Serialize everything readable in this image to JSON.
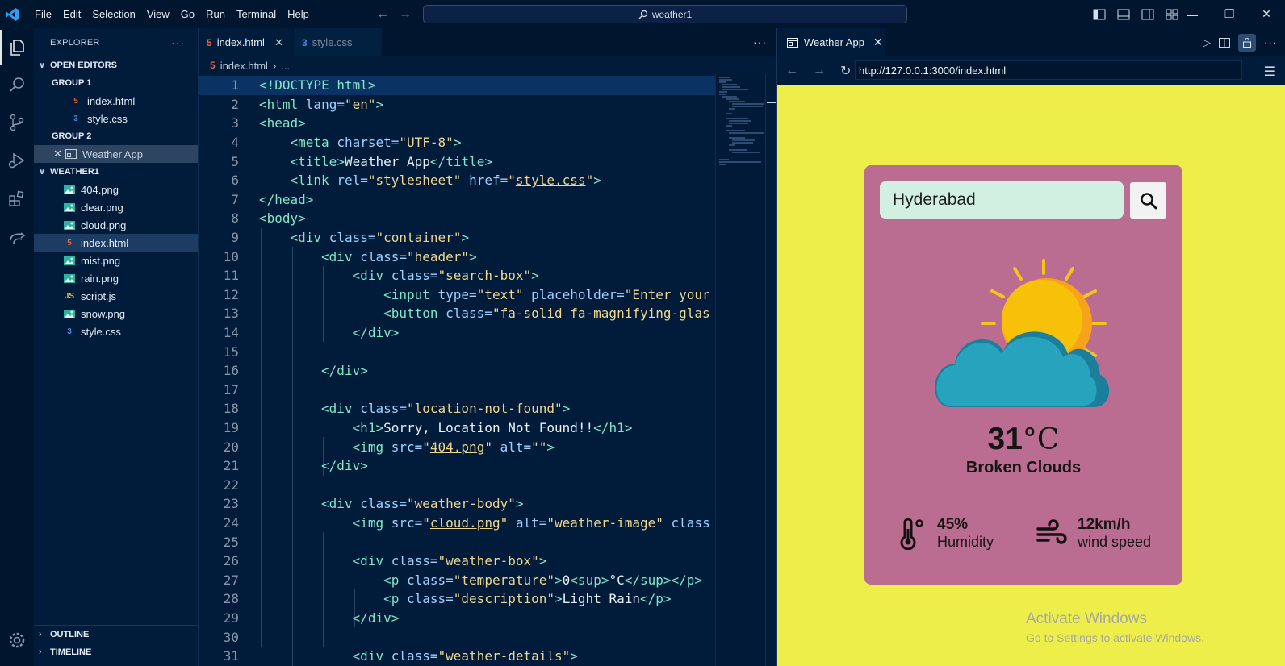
{
  "menubar": [
    "File",
    "Edit",
    "Selection",
    "View",
    "Go",
    "Run",
    "Terminal",
    "Help"
  ],
  "command_center": {
    "label": "weather1"
  },
  "explorer": {
    "title": "EXPLORER",
    "open_editors": {
      "label": "OPEN EDITORS",
      "group1": {
        "label": "GROUP 1",
        "files": [
          {
            "name": "index.html",
            "type": "html"
          },
          {
            "name": "style.css",
            "type": "css"
          }
        ]
      },
      "group2": {
        "label": "GROUP 2",
        "files": [
          {
            "name": "Weather App",
            "type": "preview"
          }
        ]
      }
    },
    "folder": {
      "label": "WEATHER1",
      "files": [
        {
          "name": "404.png",
          "type": "png"
        },
        {
          "name": "clear.png",
          "type": "png"
        },
        {
          "name": "cloud.png",
          "type": "png"
        },
        {
          "name": "index.html",
          "type": "html",
          "selected": true
        },
        {
          "name": "mist.png",
          "type": "png"
        },
        {
          "name": "rain.png",
          "type": "png"
        },
        {
          "name": "script.js",
          "type": "js"
        },
        {
          "name": "snow.png",
          "type": "png"
        },
        {
          "name": "style.css",
          "type": "css"
        }
      ]
    },
    "outline": "OUTLINE",
    "timeline": "TIMELINE"
  },
  "editor": {
    "tabs": [
      {
        "label": "index.html",
        "active": true
      },
      {
        "label": "style.css",
        "active": false
      }
    ],
    "breadcrumb": {
      "file": "index.html",
      "rest": "..."
    },
    "lines": [
      {
        "n": "1",
        "i": 0,
        "s": [
          [
            "tg",
            "<!DOCTYPE html>"
          ]
        ]
      },
      {
        "n": "2",
        "i": 0,
        "s": [
          [
            "tg",
            "<html "
          ],
          [
            "at",
            "lang="
          ],
          [
            "st",
            "\"en\""
          ],
          [
            "tg",
            ">"
          ]
        ]
      },
      {
        "n": "3",
        "i": 0,
        "s": [
          [
            "tg",
            "<head>"
          ]
        ]
      },
      {
        "n": "4",
        "i": 1,
        "s": [
          [
            "tg",
            "<meta "
          ],
          [
            "at",
            "charset="
          ],
          [
            "st",
            "\"UTF-8\""
          ],
          [
            "tg",
            ">"
          ]
        ]
      },
      {
        "n": "5",
        "i": 1,
        "s": [
          [
            "tg",
            "<title>"
          ],
          [
            "tx",
            "Weather App"
          ],
          [
            "tg",
            "</title>"
          ]
        ]
      },
      {
        "n": "6",
        "i": 1,
        "s": [
          [
            "tg",
            "<link "
          ],
          [
            "at",
            "rel="
          ],
          [
            "st",
            "\"stylesheet\""
          ],
          [
            "at",
            " href="
          ],
          [
            "st",
            "\""
          ],
          [
            "stu",
            "style.css"
          ],
          [
            "st",
            "\""
          ],
          [
            "tg",
            ">"
          ]
        ]
      },
      {
        "n": "7",
        "i": 0,
        "s": [
          [
            "tg",
            "</head>"
          ]
        ]
      },
      {
        "n": "8",
        "i": 0,
        "s": [
          [
            "tg",
            "<body>"
          ]
        ]
      },
      {
        "n": "9",
        "i": 1,
        "s": [
          [
            "tg",
            "<div "
          ],
          [
            "at",
            "class="
          ],
          [
            "st",
            "\"container\""
          ],
          [
            "tg",
            ">"
          ]
        ]
      },
      {
        "n": "10",
        "i": 2,
        "s": [
          [
            "tg",
            "<div "
          ],
          [
            "at",
            "class="
          ],
          [
            "st",
            "\"header\""
          ],
          [
            "tg",
            ">"
          ]
        ]
      },
      {
        "n": "11",
        "i": 3,
        "s": [
          [
            "tg",
            "<div "
          ],
          [
            "at",
            "class="
          ],
          [
            "st",
            "\"search-box\""
          ],
          [
            "tg",
            ">"
          ]
        ]
      },
      {
        "n": "12",
        "i": 4,
        "s": [
          [
            "tg",
            "<input "
          ],
          [
            "at",
            "type="
          ],
          [
            "st",
            "\"text\""
          ],
          [
            "at",
            " placeholder="
          ],
          [
            "st",
            "\"Enter your"
          ]
        ]
      },
      {
        "n": "13",
        "i": 4,
        "s": [
          [
            "tg",
            "<button "
          ],
          [
            "at",
            "class="
          ],
          [
            "st",
            "\"fa-solid fa-magnifying-glas"
          ]
        ]
      },
      {
        "n": "14",
        "i": 3,
        "s": [
          [
            "tg",
            "</div>"
          ]
        ]
      },
      {
        "n": "15",
        "i": 0,
        "s": []
      },
      {
        "n": "16",
        "i": 2,
        "s": [
          [
            "tg",
            "</div>"
          ]
        ]
      },
      {
        "n": "17",
        "i": 0,
        "s": []
      },
      {
        "n": "18",
        "i": 2,
        "s": [
          [
            "tg",
            "<div "
          ],
          [
            "at",
            "class="
          ],
          [
            "st",
            "\"location-not-found\""
          ],
          [
            "tg",
            ">"
          ]
        ]
      },
      {
        "n": "19",
        "i": 3,
        "s": [
          [
            "tg",
            "<h1>"
          ],
          [
            "tx",
            "Sorry, Location Not Found!!"
          ],
          [
            "tg",
            "</h1>"
          ]
        ]
      },
      {
        "n": "20",
        "i": 3,
        "s": [
          [
            "tg",
            "<img "
          ],
          [
            "at",
            "src="
          ],
          [
            "st",
            "\""
          ],
          [
            "stu",
            "404.png"
          ],
          [
            "st",
            "\""
          ],
          [
            "at",
            " alt="
          ],
          [
            "st",
            "\"\""
          ],
          [
            "tg",
            ">"
          ]
        ]
      },
      {
        "n": "21",
        "i": 2,
        "s": [
          [
            "tg",
            "</div>"
          ]
        ]
      },
      {
        "n": "22",
        "i": 0,
        "s": []
      },
      {
        "n": "23",
        "i": 2,
        "s": [
          [
            "tg",
            "<div "
          ],
          [
            "at",
            "class="
          ],
          [
            "st",
            "\"weather-body\""
          ],
          [
            "tg",
            ">"
          ]
        ]
      },
      {
        "n": "24",
        "i": 3,
        "s": [
          [
            "tg",
            "<img "
          ],
          [
            "at",
            "src="
          ],
          [
            "st",
            "\""
          ],
          [
            "stu",
            "cloud.png"
          ],
          [
            "st",
            "\""
          ],
          [
            "at",
            " alt="
          ],
          [
            "st",
            "\"weather-image\""
          ],
          [
            "at",
            " class"
          ]
        ]
      },
      {
        "n": "25",
        "i": 0,
        "s": []
      },
      {
        "n": "26",
        "i": 3,
        "s": [
          [
            "tg",
            "<div "
          ],
          [
            "at",
            "class="
          ],
          [
            "st",
            "\"weather-box\""
          ],
          [
            "tg",
            ">"
          ]
        ]
      },
      {
        "n": "27",
        "i": 4,
        "s": [
          [
            "tg",
            "<p "
          ],
          [
            "at",
            "class="
          ],
          [
            "st",
            "\"temperature\""
          ],
          [
            "tg",
            ">"
          ],
          [
            "tx",
            "0"
          ],
          [
            "tg",
            "<sup>"
          ],
          [
            "tx",
            "°C"
          ],
          [
            "tg",
            "</sup></p>"
          ]
        ]
      },
      {
        "n": "28",
        "i": 4,
        "s": [
          [
            "tg",
            "<p "
          ],
          [
            "at",
            "class="
          ],
          [
            "st",
            "\"description\""
          ],
          [
            "tg",
            ">"
          ],
          [
            "tx",
            "Light Rain"
          ],
          [
            "tg",
            "</p>"
          ]
        ]
      },
      {
        "n": "29",
        "i": 3,
        "s": [
          [
            "tg",
            "</div>"
          ]
        ]
      },
      {
        "n": "30",
        "i": 0,
        "s": []
      },
      {
        "n": "31",
        "i": 3,
        "s": [
          [
            "tg",
            "<div "
          ],
          [
            "at",
            "class="
          ],
          [
            "st",
            "\"weather-details\""
          ],
          [
            "tg",
            ">"
          ]
        ]
      }
    ]
  },
  "preview": {
    "tab_label": "Weather App",
    "url": "http://127.0.0.1:3000/index.html",
    "app": {
      "search_value": "Hyderabad",
      "temperature": "31",
      "temperature_unit": "°C",
      "description": "Broken Clouds",
      "humidity_value": "45%",
      "humidity_label": "Humidity",
      "wind_value": "12km/h",
      "wind_label": "wind speed"
    },
    "watermark": {
      "line1": "Activate Windows",
      "line2": "Go to Settings to activate Windows."
    }
  },
  "colors": {
    "page_bg": "#eeee4a",
    "card_bg": "#bb6d91",
    "input_bg": "#d2f0e2",
    "editor_bg": "#011b3b"
  }
}
